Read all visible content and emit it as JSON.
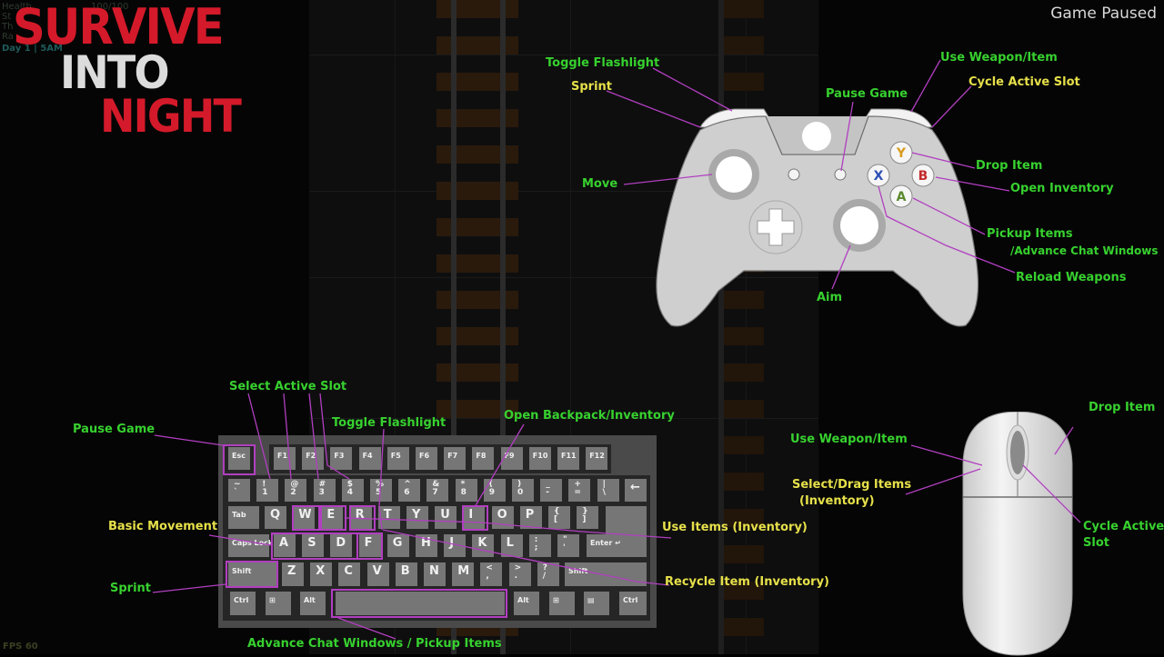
{
  "game": {
    "title_line1": "SURVIVE",
    "title_line2": "INTO",
    "title_line3": "NIGHT",
    "status": "Game Paused",
    "fps": "FPS 60",
    "hud": {
      "stats": [
        "Health",
        "St",
        "Th",
        "Ra"
      ],
      "health_value": "100/100",
      "day": "Day 1 | 5AM"
    }
  },
  "colors": {
    "label_green": "#37d12f",
    "label_yellow": "#e6e04a",
    "leader_line": "#b13fc0",
    "logo_red": "#d41a2a"
  },
  "controller": {
    "labels": {
      "toggle_flashlight": "Toggle Flashlight",
      "sprint": "Sprint",
      "move": "Move",
      "pause_game": "Pause Game",
      "use_weapon": "Use Weapon/Item",
      "cycle_slot": "Cycle Active Slot",
      "drop_item": "Drop Item",
      "open_inventory": "Open Inventory",
      "pickup_items": "Pickup Items",
      "advance_chat": "/Advance Chat Windows",
      "reload": "Reload Weapons",
      "aim": "Aim"
    },
    "buttons": {
      "y": "Y",
      "b": "B",
      "a": "A",
      "x": "X"
    }
  },
  "keyboard": {
    "labels": {
      "pause_game": "Pause Game",
      "select_slot": "Select Active Slot",
      "toggle_flashlight": "Toggle Flashlight",
      "open_backpack": "Open Backpack/Inventory",
      "basic_movement": "Basic Movement",
      "use_items": "Use Items (Inventory)",
      "sprint": "Sprint",
      "recycle": "Recycle Item (Inventory)",
      "advance_chat": "Advance Chat Windows / Pickup Items"
    },
    "keys": {
      "esc": "Esc",
      "f": [
        "F1",
        "F2",
        "F3",
        "F4",
        "F5",
        "F6",
        "F7",
        "F8",
        "F9",
        "F10",
        "F11",
        "F12"
      ],
      "num": [
        "~\n`",
        "!\n1",
        "@\n2",
        "#\n3",
        "$\n4",
        "%\n5",
        "^\n6",
        "&\n7",
        "*\n8",
        "(\n9",
        ")\n0",
        "_\n-",
        "+\n=",
        "|\n\\"
      ],
      "backspace": "←",
      "tab": "Tab",
      "row_q": [
        "Q",
        "W",
        "E",
        "R",
        "T",
        "Y",
        "U",
        "I",
        "O",
        "P",
        "{\n[",
        "}\n]"
      ],
      "caps": "Caps Lock",
      "row_a": [
        "A",
        "S",
        "D",
        "F",
        "G",
        "H",
        "J",
        "K",
        "L",
        ":\n;",
        "\"\n'"
      ],
      "enter": "Enter ↵",
      "shift": "Shift",
      "row_z": [
        "Z",
        "X",
        "C",
        "V",
        "B",
        "N",
        "M",
        "<\n,",
        ">\n.",
        "?\n/"
      ],
      "ctrl": "Ctrl",
      "win": "⊞",
      "alt": "Alt",
      "menu": "▤"
    }
  },
  "mouse": {
    "labels": {
      "drop_item": "Drop Item",
      "use_weapon": "Use Weapon/Item",
      "select_drag": "Select/Drag Items",
      "select_drag_2": "(Inventory)",
      "cycle_slot": "Cycle Active",
      "cycle_slot_2": "Slot"
    }
  }
}
